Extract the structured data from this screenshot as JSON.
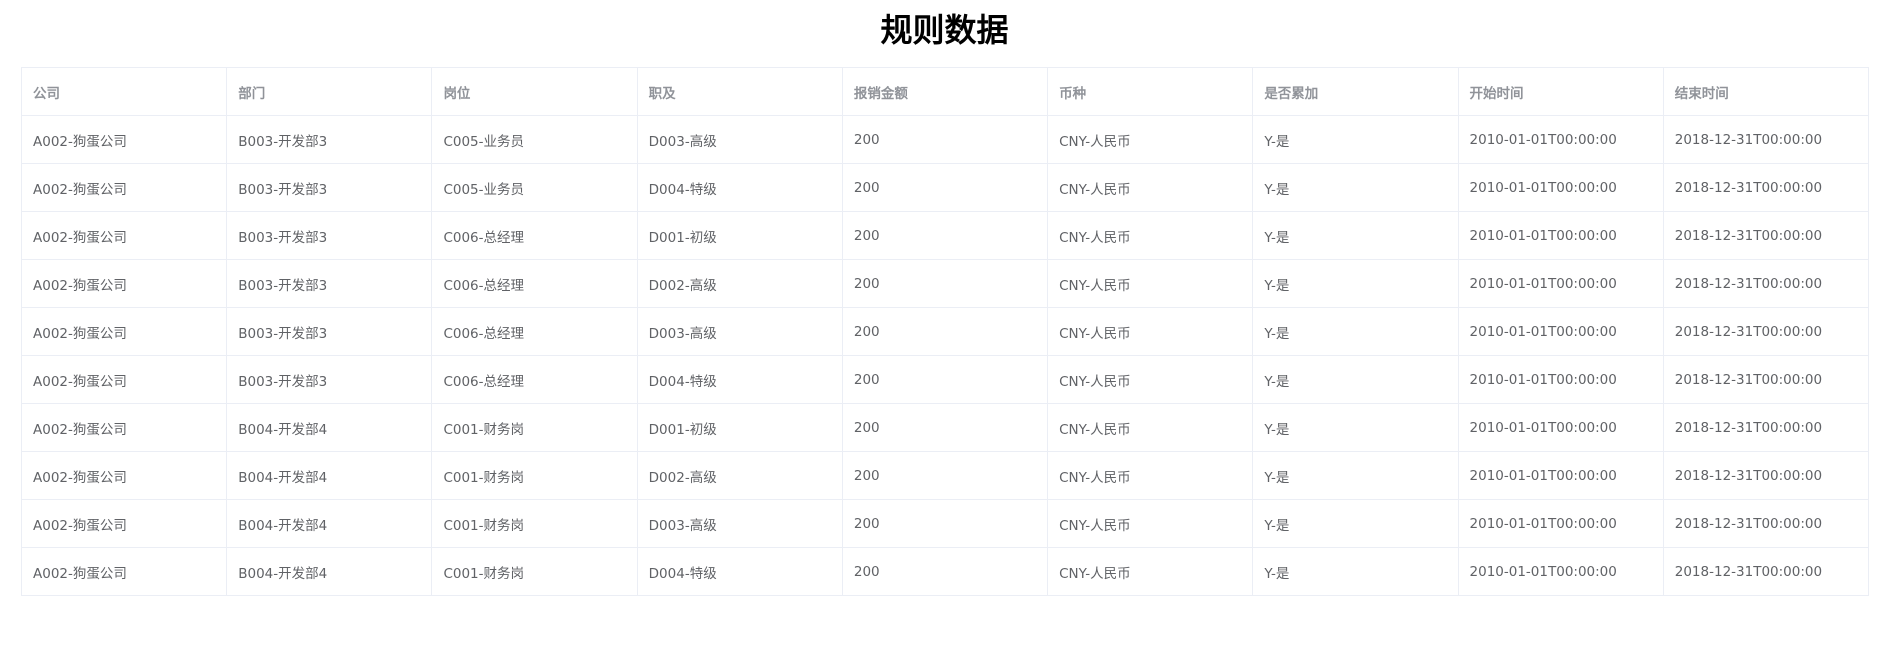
{
  "page": {
    "title": "规则数据"
  },
  "table": {
    "columns": [
      "公司",
      "部门",
      "岗位",
      "职及",
      "报销金额",
      "币种",
      "是否累加",
      "开始时间",
      "结束时间"
    ],
    "rows": [
      [
        "A002-狗蛋公司",
        "B003-开发部3",
        "C005-业务员",
        "D003-高级",
        "200",
        "CNY-人民币",
        "Y-是",
        "2010-01-01T00:00:00",
        "2018-12-31T00:00:00"
      ],
      [
        "A002-狗蛋公司",
        "B003-开发部3",
        "C005-业务员",
        "D004-特级",
        "200",
        "CNY-人民币",
        "Y-是",
        "2010-01-01T00:00:00",
        "2018-12-31T00:00:00"
      ],
      [
        "A002-狗蛋公司",
        "B003-开发部3",
        "C006-总经理",
        "D001-初级",
        "200",
        "CNY-人民币",
        "Y-是",
        "2010-01-01T00:00:00",
        "2018-12-31T00:00:00"
      ],
      [
        "A002-狗蛋公司",
        "B003-开发部3",
        "C006-总经理",
        "D002-高级",
        "200",
        "CNY-人民币",
        "Y-是",
        "2010-01-01T00:00:00",
        "2018-12-31T00:00:00"
      ],
      [
        "A002-狗蛋公司",
        "B003-开发部3",
        "C006-总经理",
        "D003-高级",
        "200",
        "CNY-人民币",
        "Y-是",
        "2010-01-01T00:00:00",
        "2018-12-31T00:00:00"
      ],
      [
        "A002-狗蛋公司",
        "B003-开发部3",
        "C006-总经理",
        "D004-特级",
        "200",
        "CNY-人民币",
        "Y-是",
        "2010-01-01T00:00:00",
        "2018-12-31T00:00:00"
      ],
      [
        "A002-狗蛋公司",
        "B004-开发部4",
        "C001-财务岗",
        "D001-初级",
        "200",
        "CNY-人民币",
        "Y-是",
        "2010-01-01T00:00:00",
        "2018-12-31T00:00:00"
      ],
      [
        "A002-狗蛋公司",
        "B004-开发部4",
        "C001-财务岗",
        "D002-高级",
        "200",
        "CNY-人民币",
        "Y-是",
        "2010-01-01T00:00:00",
        "2018-12-31T00:00:00"
      ],
      [
        "A002-狗蛋公司",
        "B004-开发部4",
        "C001-财务岗",
        "D003-高级",
        "200",
        "CNY-人民币",
        "Y-是",
        "2010-01-01T00:00:00",
        "2018-12-31T00:00:00"
      ],
      [
        "A002-狗蛋公司",
        "B004-开发部4",
        "C001-财务岗",
        "D004-特级",
        "200",
        "CNY-人民币",
        "Y-是",
        "2010-01-01T00:00:00",
        "2018-12-31T00:00:00"
      ]
    ]
  },
  "colors": {
    "header_text": "#909399",
    "cell_text": "#606266",
    "border": "#ebeef5",
    "title_text": "#000000"
  }
}
